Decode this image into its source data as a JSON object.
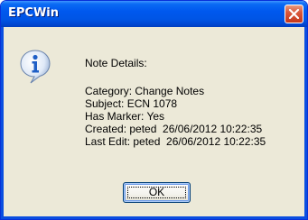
{
  "window": {
    "title": "EPCWin",
    "close_icon": "close-icon"
  },
  "message": {
    "icon": "info-icon",
    "heading": "Note Details:",
    "lines": [
      "Category: Change Notes",
      "Subject: ECN 1078",
      "Has Marker: Yes",
      "Created: peted  26/06/2012 10:22:35",
      "Last Edit: peted  26/06/2012 10:22:35"
    ]
  },
  "buttons": {
    "ok_label": "OK"
  },
  "colors": {
    "titlebar": "#0058ee",
    "close_button": "#d9583c",
    "dialog_background": "#ece9d8"
  }
}
